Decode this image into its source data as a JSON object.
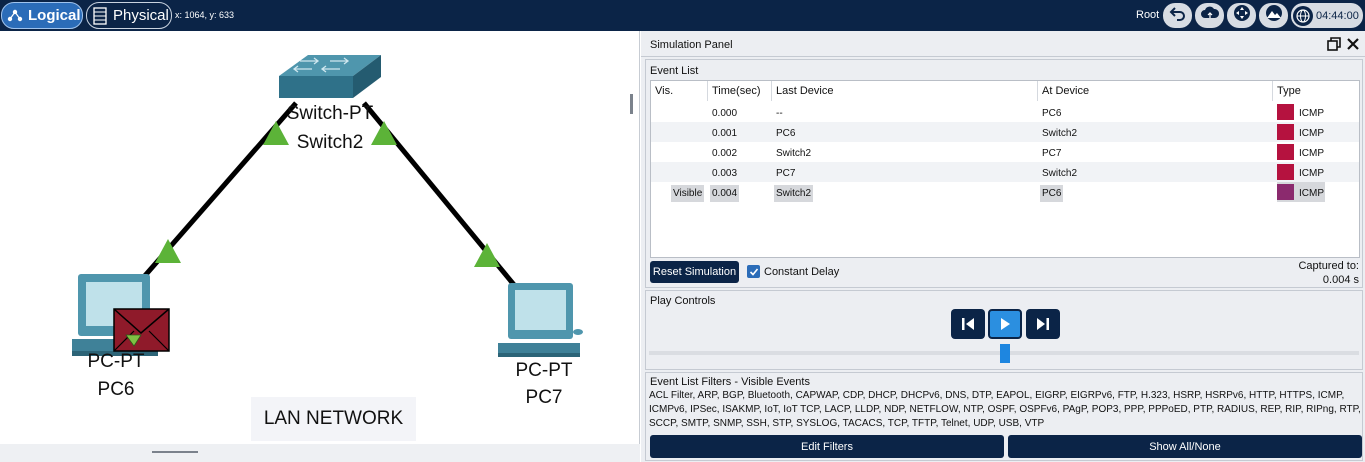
{
  "topbar": {
    "logical_label": "Logical",
    "physical_label": "Physical",
    "coords": "x: 1064, y: 633",
    "root_label": "Root",
    "time": "04:44:00"
  },
  "workspace": {
    "switch": {
      "model": "Switch-PT",
      "name": "Switch2"
    },
    "pc6": {
      "model": "PC-PT",
      "name": "PC6"
    },
    "pc7": {
      "model": "PC-PT",
      "name": "PC7"
    },
    "lan_label": "LAN NETWORK",
    "link_color": "#000000",
    "link_status_color": "#5cb338",
    "pdu_color": "#8f1a2a"
  },
  "panel": {
    "title": "Simulation Panel",
    "event_list": {
      "label": "Event List",
      "columns": [
        "Vis.",
        "Time(sec)",
        "Last Device",
        "At Device",
        "Type"
      ],
      "rows": [
        {
          "vis": "",
          "time": "0.000",
          "last": "--",
          "at": "PC6",
          "type": "ICMP",
          "color": "#b5123f"
        },
        {
          "vis": "",
          "time": "0.001",
          "last": "PC6",
          "at": "Switch2",
          "type": "ICMP",
          "color": "#b5123f"
        },
        {
          "vis": "",
          "time": "0.002",
          "last": "Switch2",
          "at": "PC7",
          "type": "ICMP",
          "color": "#b5123f"
        },
        {
          "vis": "",
          "time": "0.003",
          "last": "PC7",
          "at": "Switch2",
          "type": "ICMP",
          "color": "#b5123f"
        },
        {
          "vis": "Visible",
          "time": "0.004",
          "last": "Switch2",
          "at": "PC6",
          "type": "ICMP",
          "color": "#8b2a6e"
        }
      ],
      "reset_label": "Reset Simulation",
      "constant_delay_label": "Constant Delay",
      "captured_label": "Captured to:",
      "captured_value": "0.004 s"
    },
    "play_controls": {
      "label": "Play Controls"
    },
    "filters": {
      "label": "Event List Filters - Visible Events",
      "text": "ACL Filter, ARP, BGP, Bluetooth, CAPWAP, CDP, DHCP, DHCPv6, DNS, DTP, EAPOL, EIGRP, EIGRPv6, FTP, H.323, HSRP, HSRPv6, HTTP, HTTPS, ICMP, ICMPv6, IPSec, ISAKMP, IoT, IoT TCP, LACP, LLDP, NDP, NETFLOW, NTP, OSPF, OSPFv6, PAgP, POP3, PPP, PPPoED, PTP, RADIUS, REP, RIP, RIPng, RTP, SCCP, SMTP, SNMP, SSH, STP, SYSLOG, TACACS, TCP, TFTP, Telnet, UDP, USB, VTP",
      "edit_label": "Edit Filters",
      "show_label": "Show All/None"
    }
  }
}
